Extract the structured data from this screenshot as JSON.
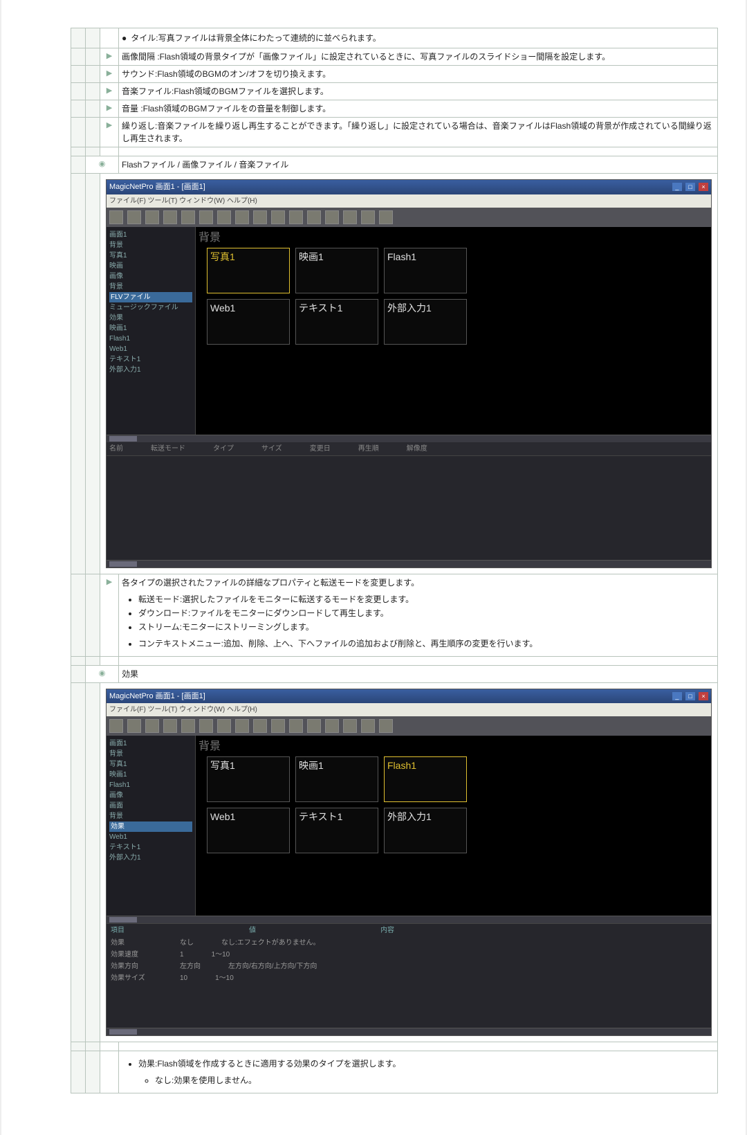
{
  "pre_bullet": "タイル:写真ファイルは背景全体にわたって連続的に並べられます。",
  "rows": [
    {
      "icon": "▶",
      "text": "画像間隔 :Flash領域の背景タイプが「画像ファイル」に設定されているときに、写真ファイルのスライドショー間隔を設定します。"
    },
    {
      "icon": "▶",
      "text": "サウンド:Flash領域のBGMのオン/オフを切り換えます。"
    },
    {
      "icon": "▶",
      "text": "音楽ファイル:Flash領域のBGMファイルを選択します。"
    },
    {
      "icon": "▶",
      "text": "音量 :Flash領域のBGMファイルをの音量を制御します。"
    },
    {
      "icon": "▶",
      "text": "繰り返し:音楽ファイルを繰り返し再生することができます。「繰り返し」に設定されている場合は、音楽ファイルはFlash領域の背景が作成されている間繰り返し再生されます。"
    }
  ],
  "section_flash_heading": "Flashファイル / 画像ファイル / 音楽ファイル",
  "section_flash_icon": "◉",
  "app": {
    "title": "MagicNetPro 画面1 - [画面1]",
    "menubar": "ファイル(F)  ツール(T)  ウィンドウ(W)  ヘルプ(H)",
    "winbtns": {
      "min": "_",
      "max": "□",
      "close": "×"
    },
    "sidebar": {
      "items": [
        "画面1",
        "背景",
        "写真1",
        "映画",
        "画像",
        "背景",
        "FLVファイル",
        "ミュージックファイル",
        "効果",
        "映画1",
        "Flash1",
        "Web1",
        "テキスト1",
        "外部入力1"
      ],
      "selected": "FLVファイル"
    },
    "canvas_header": "背景",
    "tiles": [
      {
        "label": "写真1",
        "sel": true
      },
      {
        "label": "映画1",
        "sel": false
      },
      {
        "label": "Flash1",
        "sel": false
      },
      {
        "label": "Web1",
        "sel": false
      },
      {
        "label": "テキスト1",
        "sel": false
      },
      {
        "label": "外部入力1",
        "sel": false
      }
    ],
    "statusbar": [
      "名前",
      "転送モード",
      "タイプ",
      "サイズ",
      "変更日",
      "再生順",
      "解像度"
    ]
  },
  "after_flash": {
    "icon": "▶",
    "lead": "各タイプの選択されたファイルの詳細なプロパティと転送モードを変更します。",
    "bullets": [
      "転送モード:選択したファイルをモニターに転送するモードを変更します。",
      "ダウンロード:ファイルをモニターにダウンロードして再生します。",
      "ストリーム:モニターにストリーミングします。"
    ],
    "context": "コンテキストメニュー:追加、削除、上へ、下へファイルの追加および削除と、再生順序の変更を行います。"
  },
  "section_effect_heading": "効果",
  "section_effect_icon": "◉",
  "app2": {
    "title": "MagicNetPro 画面1 - [画面1]",
    "menubar": "ファイル(F)  ツール(T)  ウィンドウ(W)  ヘルプ(H)",
    "sidebar": {
      "items": [
        "画面1",
        "背景",
        "写真1",
        "映画1",
        "Flash1",
        "画像",
        "画面",
        "背景",
        "効果",
        "Web1",
        "テキスト1",
        "外部入力1"
      ],
      "selected": "効果"
    },
    "canvas_header": "背景",
    "tiles": [
      {
        "label": "写真1",
        "sel": false
      },
      {
        "label": "映画1",
        "sel": false
      },
      {
        "label": "Flash1",
        "sel": true
      },
      {
        "label": "Web1",
        "sel": false
      },
      {
        "label": "テキスト1",
        "sel": false
      },
      {
        "label": "外部入力1",
        "sel": false
      }
    ],
    "panel": {
      "headers": [
        "項目",
        "値",
        "内容"
      ],
      "rows": [
        [
          "効果",
          "なし",
          "なし:エフェクトがありません。"
        ],
        [
          "効果速度",
          "1",
          "1～10"
        ],
        [
          "効果方向",
          "左方向",
          "左方向/右方向/上方向/下方向"
        ],
        [
          "効果サイズ",
          "10",
          "1～10"
        ]
      ]
    }
  },
  "tail_bullet": "効果:Flash領域を作成するときに適用する効果のタイプを選択します。",
  "tail_sub": "なし:効果を使用しません。"
}
